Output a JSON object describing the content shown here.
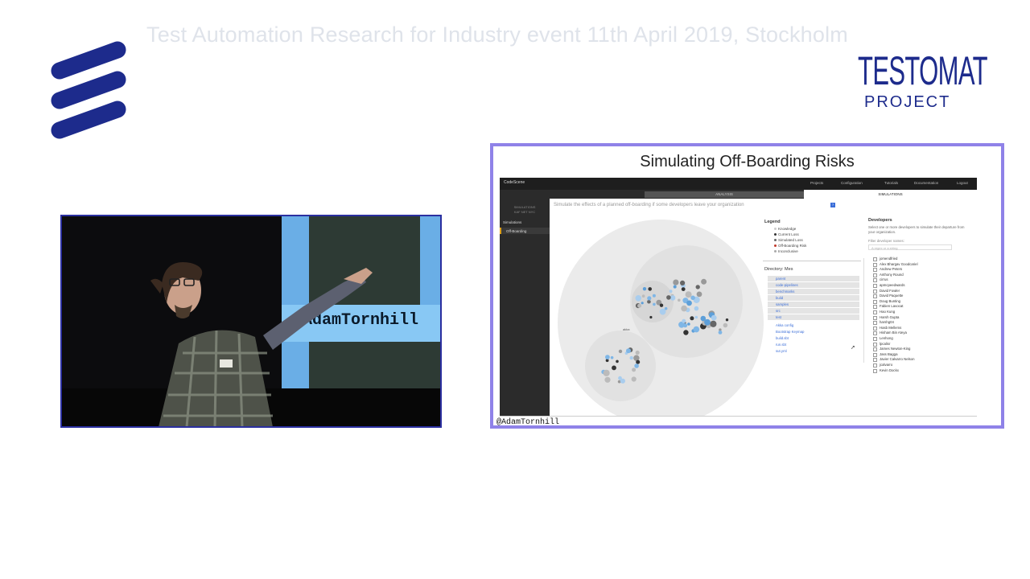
{
  "event_title": "Test Automation Research for Industry event 11th April 2019, Stockholm",
  "logos": {
    "left": "ericsson-logo",
    "right_top": "TESTOMAT",
    "right_bottom": "PROJECT",
    "brand_blue": "#1d2b8c",
    "brand_green": "#2e8a3a"
  },
  "video": {
    "screen_handle": "@AdamTornhill"
  },
  "slide": {
    "title": "Simulating Off-Boarding Risks",
    "footer_handle": "@AdamTornhill",
    "frame_color": "#8f82e8",
    "app": {
      "brand": "CodeScene",
      "nav": [
        "Projects",
        "Configuration",
        "Tutorials",
        "Documentation",
        "Logout"
      ],
      "tabs": [
        "ANALYSIS",
        "SIMULATIONS"
      ],
      "sidebar_title": "SIMULATIONS",
      "sidebar_subtitle": "KAF NET NYC",
      "sidebar_items": [
        "Simulations",
        "Off-Boarding"
      ],
      "description": "Simulate the effects of a planned off-boarding if some developers leave your organization",
      "legend": {
        "title": "Legend",
        "items": [
          {
            "label": "Knowledge",
            "color": "#cccccc"
          },
          {
            "label": "Current Loss",
            "color": "#333333"
          },
          {
            "label": "Simulated Loss",
            "color": "#666666"
          },
          {
            "label": "Off-Boarding Risk",
            "color": "#c0392b"
          },
          {
            "label": "Inconclusive",
            "color": "#aaaaaa"
          }
        ]
      },
      "directory": {
        "label": "Directory: Mes",
        "items": [
          "parent",
          "code-pipelines",
          "benchmarks",
          "build",
          "samples",
          "src",
          "test",
          "Akka config",
          "Bootstrap Keymap",
          "build.sbt",
          "run.sbt",
          "sut.yml"
        ]
      },
      "developers": {
        "title": "Developers",
        "description": "Select one or more developers to simulate their departure from your organization.",
        "filter_label": "Filter developer names:",
        "filter_placeholder": "A regex or a string",
        "names": [
          "jomendfried",
          "Alex Bhargav Goodcariel",
          "Andrew Peters",
          "Anthony Round",
          "cirrus",
          "apmcpeedwards",
          "David Fowler",
          "David Paquette",
          "Doug Bunting",
          "Fabien Lavocat",
          "Hao Kung",
          "Harsh Gupta",
          "harshg04",
          "Hasb Mellems",
          "Hisham Bin Ateya",
          "Lenhong",
          "lpcalisr",
          "James Newton-King",
          "Jass Bagga",
          "Javier Calvarro Nelson",
          "jcalvarro",
          "Kevin Dockx"
        ]
      }
    }
  }
}
